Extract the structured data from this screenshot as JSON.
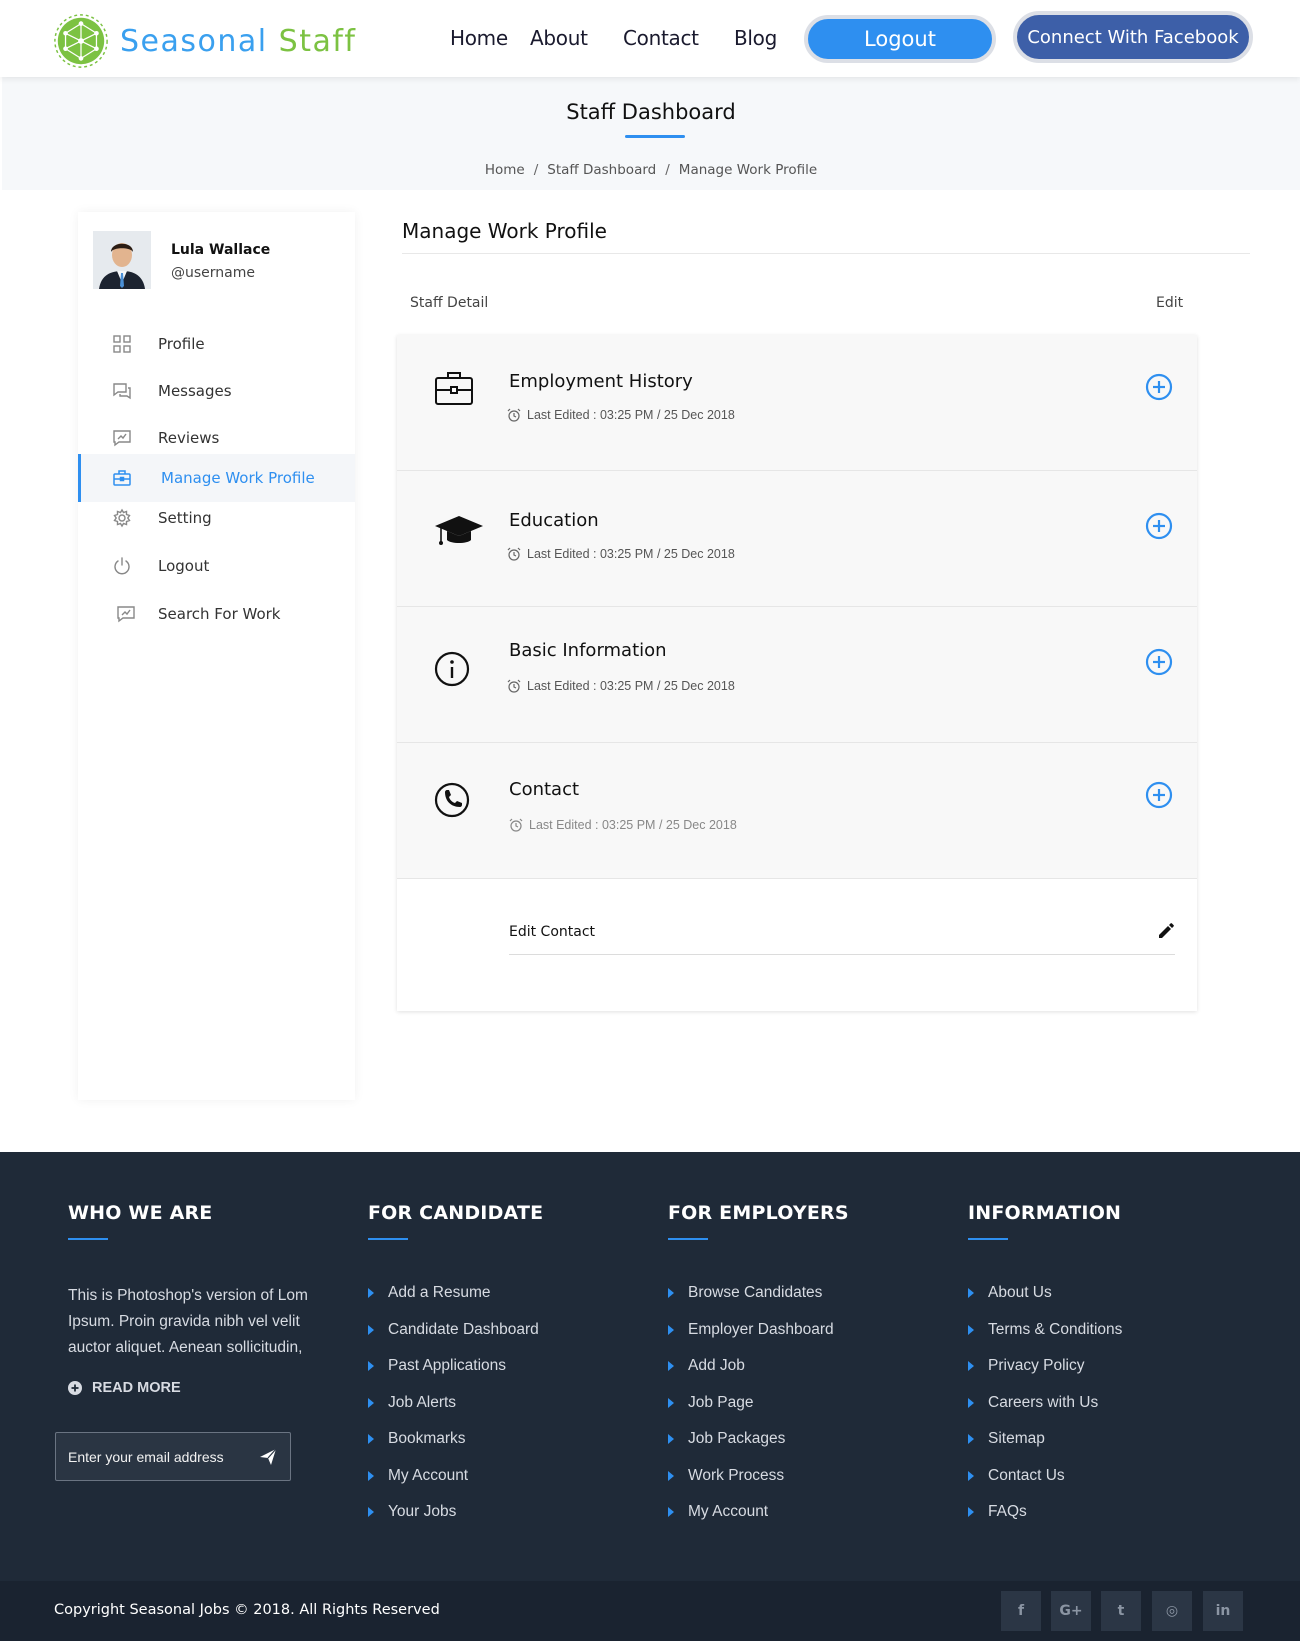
{
  "brand": {
    "name_part1": "Seasonal",
    "name_part2": "Staff",
    "logo_icon": "network-globe-icon"
  },
  "nav": {
    "items": [
      "Home",
      "About",
      "Contact",
      "Blog"
    ],
    "logout": "Logout",
    "facebook": "Connect With Facebook"
  },
  "page": {
    "title": "Staff Dashboard",
    "breadcrumb": [
      "Home",
      "Staff Dashboard",
      "Manage Work Profile"
    ],
    "separator": "/"
  },
  "user": {
    "name": "Lula Wallace",
    "handle": "@username"
  },
  "sidebar": {
    "items": [
      {
        "label": "Profile",
        "icon": "dashboard-grid-icon"
      },
      {
        "label": "Messages",
        "icon": "chat-icon"
      },
      {
        "label": "Reviews",
        "icon": "review-icon"
      },
      {
        "label": "Manage Work Profile",
        "icon": "briefcase-icon",
        "active": true
      },
      {
        "label": "Setting",
        "icon": "gear-icon"
      },
      {
        "label": "Logout",
        "icon": "power-icon"
      },
      {
        "label": "Search For Work",
        "icon": "search-work-icon"
      }
    ]
  },
  "main": {
    "title": "Manage Work Profile",
    "staff_detail": "Staff Detail",
    "edit": "Edit",
    "sections": [
      {
        "title": "Employment History",
        "meta": "Last Edited : 03:25 PM / 25 Dec 2018",
        "icon": "briefcase-icon"
      },
      {
        "title": "Education",
        "meta": "Last Edited : 03:25 PM / 25 Dec 2018",
        "icon": "graduation-cap-icon"
      },
      {
        "title": "Basic Information",
        "meta": "Last Edited : 03:25 PM / 25 Dec 2018",
        "icon": "info-icon"
      },
      {
        "title": "Contact",
        "meta": "Last Edited : 03:25 PM / 25 Dec 2018",
        "icon": "phone-icon"
      }
    ],
    "edit_contact": "Edit Contact"
  },
  "footer": {
    "who": {
      "heading": "WHO WE ARE",
      "text": "This is Photoshop's version of Lom Ipsum. Proin gravida nibh vel velit auctor aliquet. Aenean sollicitudin,",
      "read_more": "READ MORE",
      "email_placeholder": "Enter your email address"
    },
    "candidate": {
      "heading": "FOR CANDIDATE",
      "links": [
        "Add a Resume",
        "Candidate Dashboard",
        "Past Applications",
        "Job Alerts",
        "Bookmarks",
        "My Account",
        "Your Jobs"
      ]
    },
    "employers": {
      "heading": "FOR EMPLOYERS",
      "links": [
        "Browse Candidates",
        "Employer Dashboard",
        "Add Job",
        "Job Page",
        "Job Packages",
        "Work Process",
        "My Account"
      ]
    },
    "info": {
      "heading": "INFORMATION",
      "links": [
        "About Us",
        "Terms & Conditions",
        "Privacy Policy",
        "Careers with Us",
        "Sitemap",
        "Contact Us",
        "FAQs"
      ]
    },
    "copyright": "Copyright Seasonal Jobs © 2018. All Rights Reserved",
    "social": [
      {
        "glyph": "f",
        "icon": "facebook-icon"
      },
      {
        "glyph": "G+",
        "icon": "google-plus-icon"
      },
      {
        "glyph": "t",
        "icon": "twitter-icon"
      },
      {
        "glyph": "◎",
        "icon": "instagram-icon"
      },
      {
        "glyph": "in",
        "icon": "linkedin-icon"
      }
    ]
  },
  "colors": {
    "accent": "#2e8ff0",
    "brand_green": "#7cc242",
    "facebook": "#3d5fa8",
    "footer_bg": "#1f2a38"
  }
}
